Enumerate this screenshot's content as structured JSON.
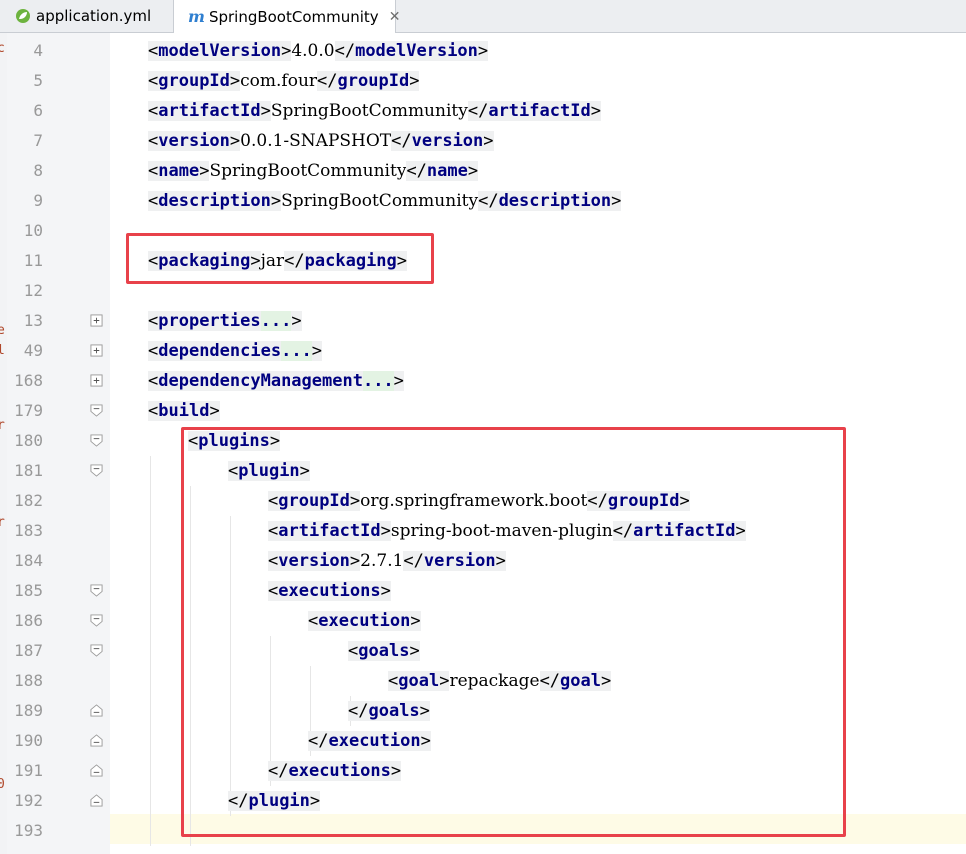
{
  "tabs": [
    {
      "label": "application.yml",
      "icon": "spring-leaf-icon",
      "active": false
    },
    {
      "label": "SpringBootCommunity",
      "icon": "maven-icon",
      "active": true
    }
  ],
  "left_strip_fragments": [
    "c",
    "e",
    "l",
    "r",
    "r",
    "0"
  ],
  "lines": [
    {
      "n": "4",
      "indent": 1,
      "parts": [
        {
          "t": "tag",
          "v": "modelVersion"
        },
        {
          "t": "text",
          "v": "4.0.0"
        },
        {
          "t": "close",
          "v": "modelVersion"
        }
      ]
    },
    {
      "n": "5",
      "indent": 1,
      "parts": [
        {
          "t": "tag",
          "v": "groupId"
        },
        {
          "t": "text",
          "v": "com.four"
        },
        {
          "t": "close",
          "v": "groupId"
        }
      ]
    },
    {
      "n": "6",
      "indent": 1,
      "parts": [
        {
          "t": "tag",
          "v": "artifactId"
        },
        {
          "t": "text",
          "v": "SpringBootCommunity"
        },
        {
          "t": "close",
          "v": "artifactId"
        }
      ]
    },
    {
      "n": "7",
      "indent": 1,
      "parts": [
        {
          "t": "tag",
          "v": "version"
        },
        {
          "t": "text",
          "v": "0.0.1-SNAPSHOT"
        },
        {
          "t": "close",
          "v": "version"
        }
      ]
    },
    {
      "n": "8",
      "indent": 1,
      "parts": [
        {
          "t": "tag",
          "v": "name"
        },
        {
          "t": "text",
          "v": "SpringBootCommunity"
        },
        {
          "t": "close",
          "v": "name"
        }
      ]
    },
    {
      "n": "9",
      "indent": 1,
      "parts": [
        {
          "t": "tag",
          "v": "description"
        },
        {
          "t": "text",
          "v": "SpringBootCommunity"
        },
        {
          "t": "close",
          "v": "description"
        }
      ]
    },
    {
      "n": "10",
      "indent": 1,
      "parts": []
    },
    {
      "n": "11",
      "indent": 1,
      "parts": [
        {
          "t": "tag",
          "v": "packaging"
        },
        {
          "t": "text",
          "v": "jar"
        },
        {
          "t": "close",
          "v": "packaging"
        }
      ]
    },
    {
      "n": "12",
      "indent": 1,
      "parts": []
    },
    {
      "n": "13",
      "indent": 1,
      "fold": "plus",
      "parts": [
        {
          "t": "folded",
          "v": "properties"
        }
      ]
    },
    {
      "n": "49",
      "indent": 1,
      "fold": "plus",
      "parts": [
        {
          "t": "folded",
          "v": "dependencies"
        }
      ]
    },
    {
      "n": "168",
      "indent": 1,
      "fold": "plus",
      "parts": [
        {
          "t": "folded",
          "v": "dependencyManagement"
        }
      ]
    },
    {
      "n": "179",
      "indent": 1,
      "fold": "open",
      "parts": [
        {
          "t": "tag",
          "v": "build"
        }
      ]
    },
    {
      "n": "180",
      "indent": 2,
      "fold": "open",
      "parts": [
        {
          "t": "tag",
          "v": "plugins"
        }
      ]
    },
    {
      "n": "181",
      "indent": 3,
      "fold": "open",
      "parts": [
        {
          "t": "tag",
          "v": "plugin"
        }
      ]
    },
    {
      "n": "182",
      "indent": 4,
      "parts": [
        {
          "t": "tag",
          "v": "groupId"
        },
        {
          "t": "text",
          "v": "org.springframework.boot"
        },
        {
          "t": "close",
          "v": "groupId"
        }
      ]
    },
    {
      "n": "183",
      "indent": 4,
      "parts": [
        {
          "t": "tag",
          "v": "artifactId"
        },
        {
          "t": "text",
          "v": "spring-boot-maven-plugin"
        },
        {
          "t": "close",
          "v": "artifactId"
        }
      ]
    },
    {
      "n": "184",
      "indent": 4,
      "parts": [
        {
          "t": "tag",
          "v": "version"
        },
        {
          "t": "text",
          "v": "2.7.1"
        },
        {
          "t": "close",
          "v": "version"
        }
      ]
    },
    {
      "n": "185",
      "indent": 4,
      "fold": "open",
      "parts": [
        {
          "t": "tag",
          "v": "executions"
        }
      ]
    },
    {
      "n": "186",
      "indent": 5,
      "fold": "open",
      "parts": [
        {
          "t": "tag",
          "v": "execution"
        }
      ]
    },
    {
      "n": "187",
      "indent": 6,
      "fold": "open",
      "parts": [
        {
          "t": "tag",
          "v": "goals"
        }
      ]
    },
    {
      "n": "188",
      "indent": 7,
      "parts": [
        {
          "t": "tag",
          "v": "goal"
        },
        {
          "t": "text",
          "v": "repackage"
        },
        {
          "t": "close",
          "v": "goal"
        }
      ]
    },
    {
      "n": "189",
      "indent": 6,
      "fold": "end",
      "parts": [
        {
          "t": "close",
          "v": "goals"
        }
      ]
    },
    {
      "n": "190",
      "indent": 5,
      "fold": "end",
      "parts": [
        {
          "t": "close",
          "v": "execution"
        }
      ]
    },
    {
      "n": "191",
      "indent": 4,
      "fold": "end",
      "parts": [
        {
          "t": "close",
          "v": "executions"
        }
      ]
    },
    {
      "n": "192",
      "indent": 3,
      "fold": "end",
      "parts": [
        {
          "t": "close",
          "v": "plugin"
        }
      ]
    },
    {
      "n": "193",
      "indent": 2,
      "parts": [],
      "current": true
    }
  ],
  "colors": {
    "tag": "#000080",
    "highlight_box": "#e8414a",
    "current_line": "#fefbe6"
  }
}
